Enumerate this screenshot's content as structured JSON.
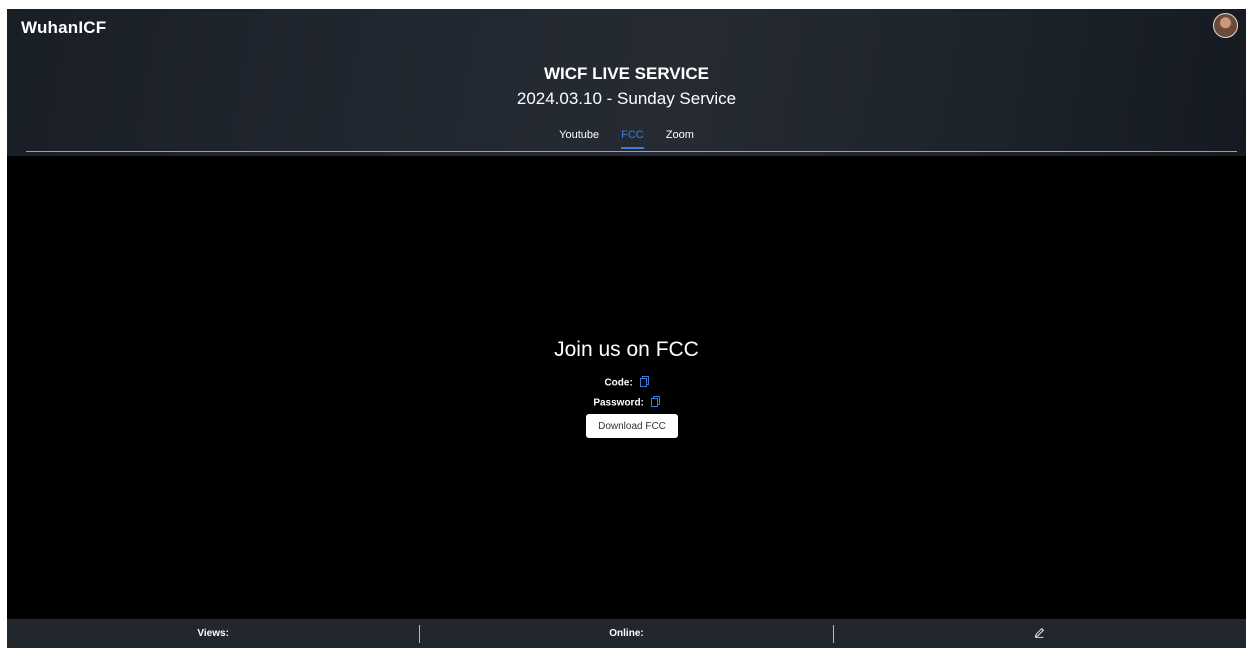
{
  "header": {
    "brand": "WuhanICF",
    "title": "WICF LIVE SERVICE",
    "subtitle": "2024.03.10 - Sunday Service",
    "tabs": [
      {
        "label": "Youtube",
        "active": false
      },
      {
        "label": "FCC",
        "active": true
      },
      {
        "label": "Zoom",
        "active": false
      }
    ],
    "accent_color": "#3a7bd5"
  },
  "main": {
    "heading": "Join us on FCC",
    "code_label": "Code:",
    "password_label": "Password:",
    "download_label": "Download FCC"
  },
  "footer": {
    "views_label": "Views:",
    "online_label": "Online:",
    "edit_icon": "pencil-icon"
  }
}
